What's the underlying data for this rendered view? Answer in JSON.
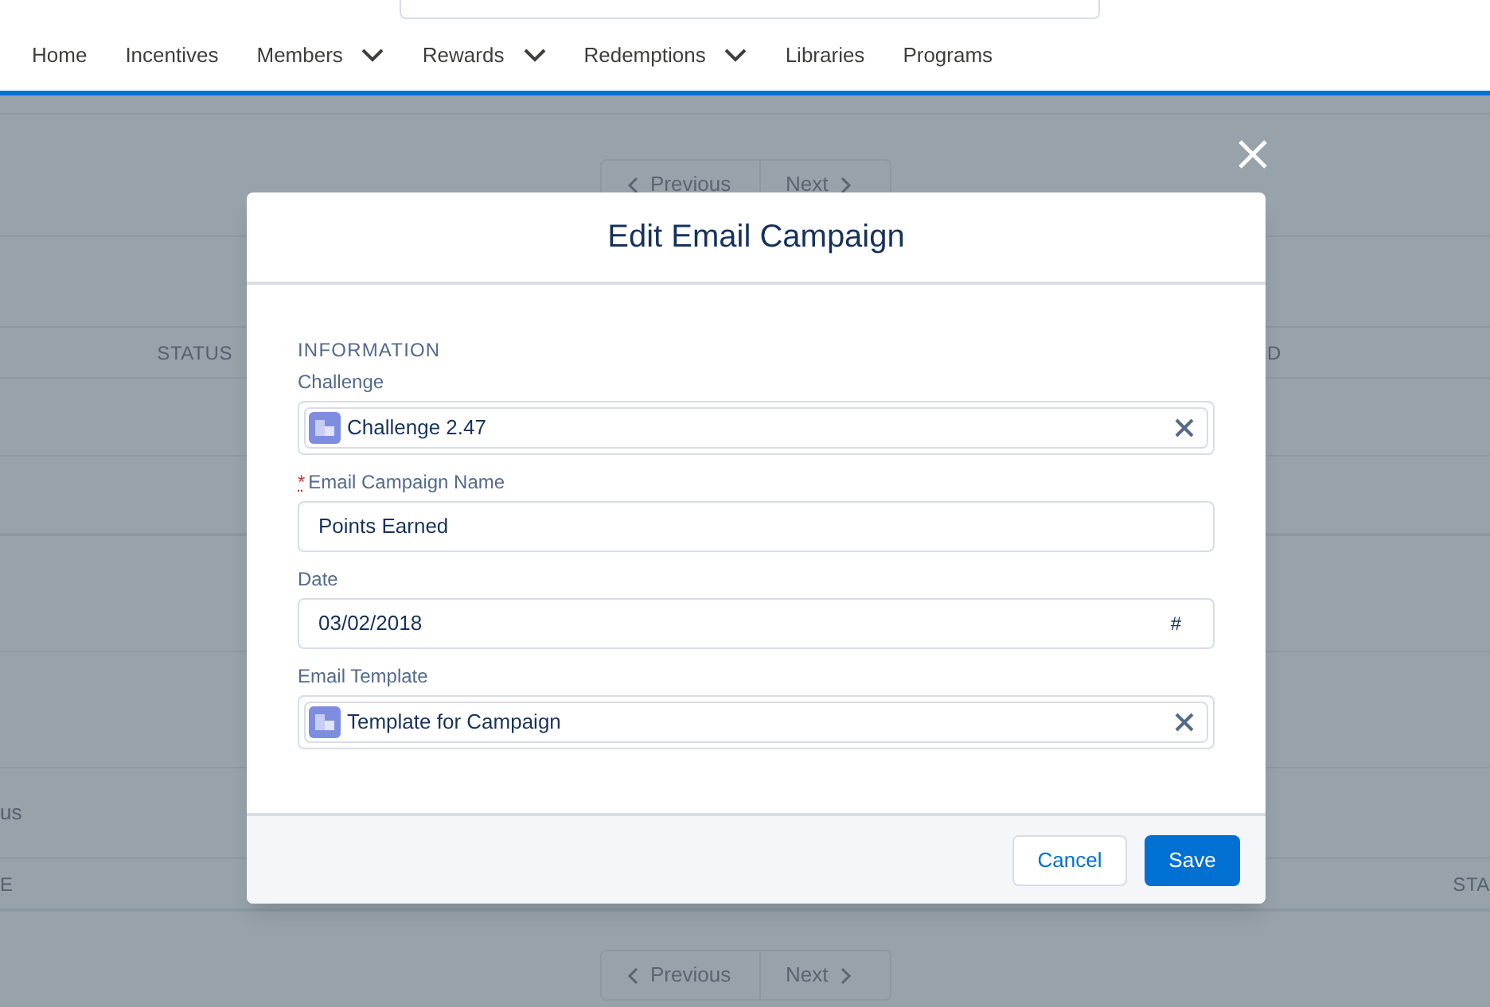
{
  "nav": {
    "items": [
      {
        "label": "Home",
        "dropdown": false
      },
      {
        "label": "Incentives",
        "dropdown": false
      },
      {
        "label": "Members",
        "dropdown": true
      },
      {
        "label": "Rewards",
        "dropdown": true
      },
      {
        "label": "Redemptions",
        "dropdown": true
      },
      {
        "label": "Libraries",
        "dropdown": false
      },
      {
        "label": "Programs",
        "dropdown": false
      }
    ]
  },
  "background": {
    "pagination_top": {
      "previous": "Previous",
      "next": "Next"
    },
    "table_header": {
      "column_1": "STATUS",
      "column_2": "D"
    },
    "row_text": "us",
    "table_header_2": {
      "column_1": "E",
      "column_2": "STA"
    },
    "pagination_bottom": {
      "previous": "Previous",
      "next": "Next"
    }
  },
  "modal": {
    "title": "Edit Email Campaign",
    "section_heading": "INFORMATION",
    "fields": [
      {
        "kind": "lookup",
        "label": "Challenge",
        "value": "Challenge 2.47"
      },
      {
        "kind": "text",
        "label": "Email Campaign Name",
        "required_mark": "*",
        "value": "Points Earned"
      },
      {
        "kind": "date",
        "label": "Date",
        "value": "03/02/2018",
        "trailing_text": "#"
      },
      {
        "kind": "lookup",
        "label": "Email Template",
        "value": "Template for Campaign"
      }
    ],
    "buttons": [
      {
        "label": "Cancel",
        "kind": "neutral"
      },
      {
        "label": "Save",
        "kind": "brand"
      }
    ]
  }
}
